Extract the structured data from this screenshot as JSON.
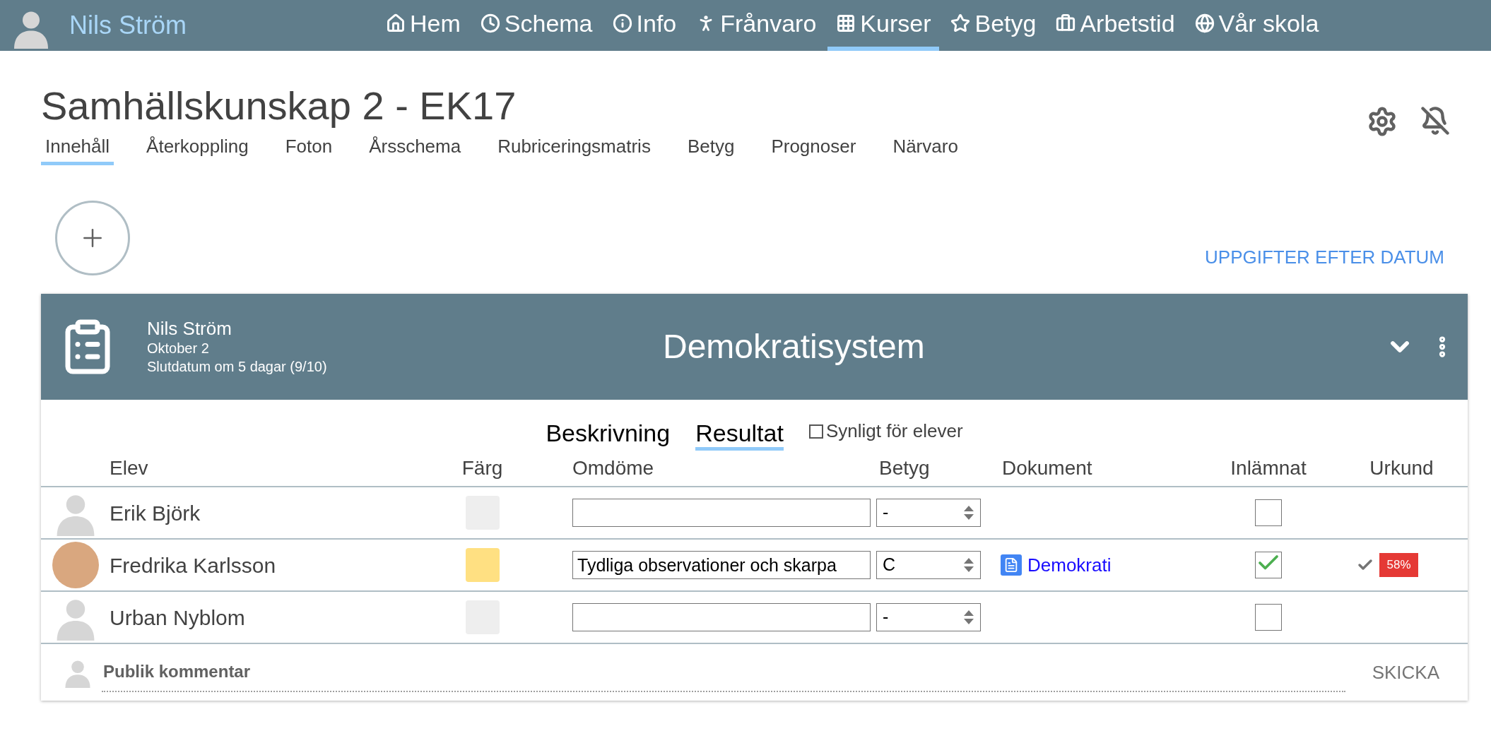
{
  "user": {
    "name": "Nils Ström"
  },
  "nav": [
    {
      "label": "Hem",
      "selected": false
    },
    {
      "label": "Schema",
      "selected": false
    },
    {
      "label": "Info",
      "selected": false
    },
    {
      "label": "Frånvaro",
      "selected": false
    },
    {
      "label": "Kurser",
      "selected": true
    },
    {
      "label": "Betyg",
      "selected": false
    },
    {
      "label": "Arbetstid",
      "selected": false
    },
    {
      "label": "Vår skola",
      "selected": false
    }
  ],
  "course": {
    "title": "Samhällskunskap 2 - EK17",
    "tabs": [
      {
        "label": "Innehåll",
        "selected": true
      },
      {
        "label": "Återkoppling",
        "selected": false
      },
      {
        "label": "Foton",
        "selected": false
      },
      {
        "label": "Årsschema",
        "selected": false
      },
      {
        "label": "Rubriceringsmatris",
        "selected": false
      },
      {
        "label": "Betyg",
        "selected": false
      },
      {
        "label": "Prognoser",
        "selected": false
      },
      {
        "label": "Närvaro",
        "selected": false
      }
    ]
  },
  "tasks_link": "UPPGIFTER EFTER DATUM",
  "assignment": {
    "author": "Nils Ström",
    "date": "Oktober 2",
    "deadline": "Slutdatum om 5 dagar (9/10)",
    "title": "Demokratisystem",
    "tabs": [
      {
        "label": "Beskrivning",
        "selected": false
      },
      {
        "label": "Resultat",
        "selected": true
      }
    ],
    "visible_to_students": {
      "label": "Synligt för elever",
      "checked": false
    },
    "columns": [
      "Elev",
      "Färg",
      "Omdöme",
      "Betyg",
      "Dokument",
      "Inlämnat",
      "Urkund"
    ],
    "rows": [
      {
        "name": "Erik Björk",
        "avatar": {
          "kind": "silhouette"
        },
        "color": "#eeeeee",
        "grade": "-",
        "submitted": false
      },
      {
        "name": "Fredrika Karlsson",
        "avatar": {
          "kind": "photo"
        },
        "color": "#ffe082",
        "assessment": "Tydliga observationer och skarpa",
        "grade": "C",
        "document": "Demokrati",
        "submitted": true,
        "urkund": {
          "checked": true,
          "score": "58%"
        }
      },
      {
        "name": "Urban Nyblom",
        "avatar": {
          "kind": "silhouette"
        },
        "color": "#eeeeee",
        "grade": "-",
        "submitted": false
      }
    ],
    "comment": {
      "placeholder": "Publik kommentar",
      "send": "SKICKA"
    }
  }
}
